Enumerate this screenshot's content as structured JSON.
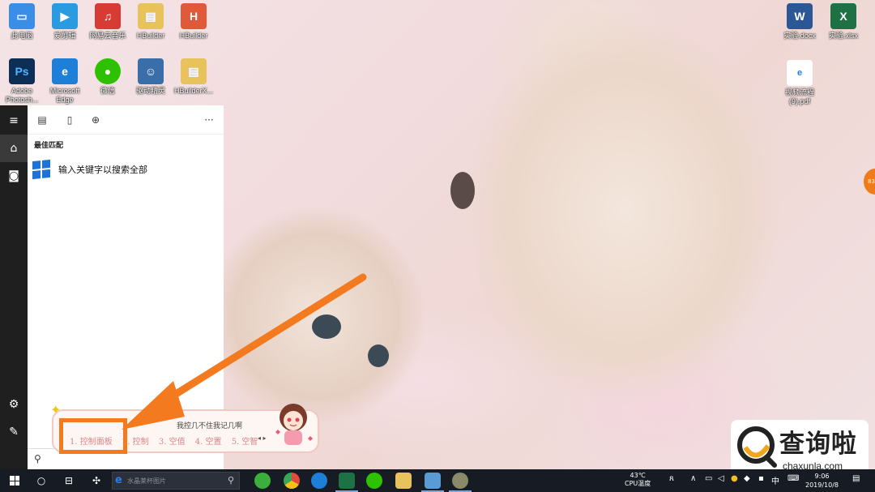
{
  "desktop": {
    "icons_left": [
      {
        "label": "此电脑",
        "icon": "computer-icon",
        "color": "#3a8ee6"
      },
      {
        "label": "爱剪辑",
        "icon": "film-icon",
        "color": "#2a9be0"
      },
      {
        "label": "网易云音乐",
        "icon": "music-icon",
        "color": "#d83b34"
      },
      {
        "label": "HBuilder",
        "icon": "folder-icon",
        "color": "#e8c25a"
      },
      {
        "label": "HBuilder",
        "icon": "hbuilder-icon",
        "color": "#e05a3a"
      }
    ],
    "icons_left_row2": [
      {
        "label": "Adobe Photosh...",
        "icon": "photoshop-icon",
        "color": "#0d2f55"
      },
      {
        "label": "Microsoft Edge",
        "icon": "edge-icon",
        "color": "#1e7fd8"
      },
      {
        "label": "微信",
        "icon": "wechat-icon",
        "color": "#2dc100"
      },
      {
        "label": "驱动精灵",
        "icon": "driver-icon",
        "color": "#3a6ea8"
      },
      {
        "label": "HBuilderX...",
        "icon": "folder-icon",
        "color": "#e8c25a"
      }
    ],
    "icons_right": [
      {
        "label": "实验.docx",
        "icon": "word-icon",
        "color": "#2b5797"
      },
      {
        "label": "实验.xlsx",
        "icon": "excel-icon",
        "color": "#1e7145"
      },
      {
        "label": "视频流程(9).pdf",
        "icon": "pdf-icon",
        "color": "#1e7fd8"
      }
    ]
  },
  "start_menu": {
    "best_match_label": "最佳匹配",
    "result_text": "输入关键字以搜索全部",
    "more_label": "···"
  },
  "ime": {
    "top_text": "我控几不住我记几啊",
    "candidates": [
      "1. 控制面板",
      "2. 控制",
      "3. 空值",
      "4. 空置",
      "5. 空智"
    ]
  },
  "side_ball_text": "83",
  "watermark": {
    "title": "查询啦",
    "url": "chaxunla.com"
  },
  "taskbar": {
    "search_placeholder": "水晶莱杯图片",
    "temp": "43℃",
    "temp_label": "CPU温度",
    "ime_lang": "中",
    "time": "9:06",
    "date": "2019/10/8"
  },
  "colors": {
    "accent_orange": "#f47a20",
    "taskbar": "#171c24",
    "start_rail": "#1f1f1f"
  }
}
